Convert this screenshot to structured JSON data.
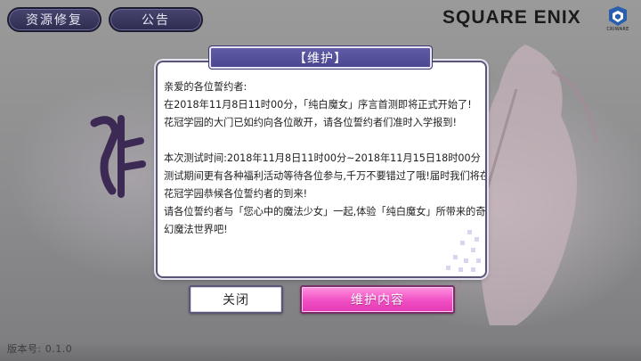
{
  "top_buttons": {
    "repair_label": "资源修复",
    "notice_label": "公告"
  },
  "logos": {
    "brand": "SQUARE ENIX",
    "cri_label": "CRIWARE"
  },
  "dialog": {
    "title": "【维护】",
    "lines": [
      "亲爱的各位誓约者:",
      "在2018年11月8日11时00分，「纯白魔女」序言首测即将正式开始了!",
      "花冠学园的大门已如约向各位敞开，请各位誓约者们准时入学报到!",
      "",
      "本次测试时间:2018年11月8日11时00分~2018年11月15日18时00分",
      "测试期间更有各种福利活动等待各位参与,千万不要错过了哦!届时我们将在",
      "花冠学园恭候各位誓约者的到来!",
      "请各位誓约者与「您心中的魔法少女」一起,体验「纯白魔女」所带来的奇",
      "幻魔法世界吧!"
    ],
    "close_label": "关闭",
    "content_label": "维护内容"
  },
  "footer": {
    "version": "版本号: 0.1.0"
  },
  "colors": {
    "title_bar": "#544f98",
    "content_button": "#f04ec3",
    "top_button": "#3a3860"
  }
}
